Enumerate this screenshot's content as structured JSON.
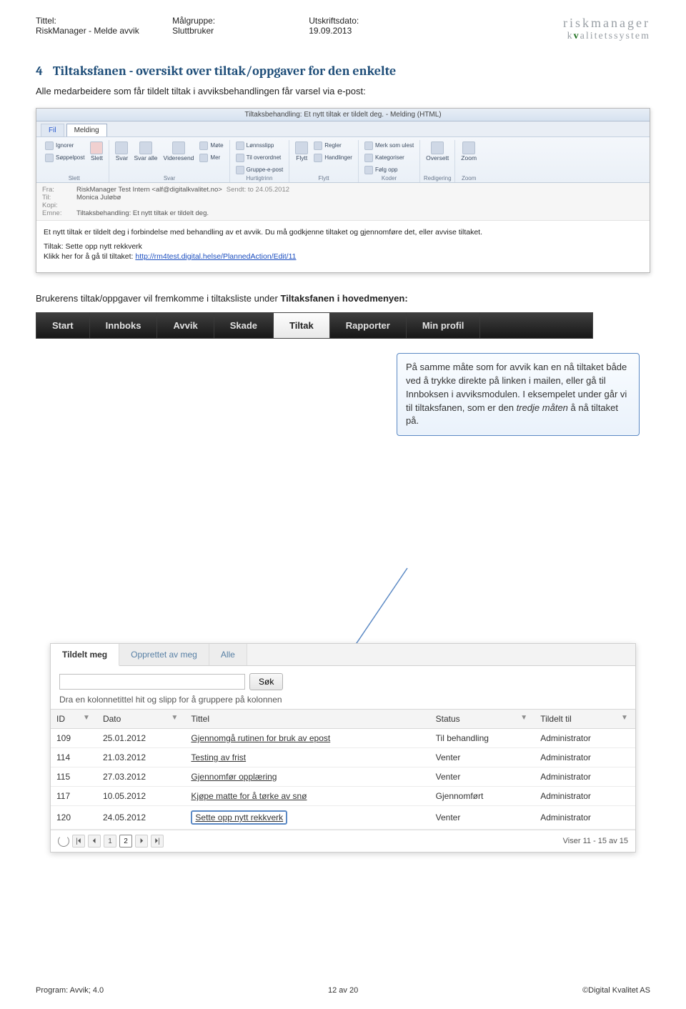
{
  "header": {
    "title_label": "Tittel:",
    "title_value": "RiskManager - Melde avvik",
    "audience_label": "Målgruppe:",
    "audience_value": "Sluttbruker",
    "date_label": "Utskriftsdato:",
    "date_value": "19.09.2013",
    "logo_line1": "riskmanager",
    "logo_line2_pre": "k",
    "logo_line2_mid": "v",
    "logo_line2_post": "alitetssystem"
  },
  "section": {
    "number": "4",
    "title": "Tiltaksfanen - oversikt over tiltak/oppgaver for den enkelte",
    "para1": "Alle medarbeidere som får tildelt tiltak i avviksbehandlingen får varsel via e-post:"
  },
  "outlook": {
    "window_title": "Tiltaksbehandling: Et nytt tiltak er tildelt deg. - Melding (HTML)",
    "tabs": {
      "file": "Fil",
      "message": "Melding"
    },
    "ribbon": {
      "ignore": "Ignorer",
      "junk": "Søppelpost",
      "delete": "Slett",
      "reply": "Svar",
      "replyall": "Svar alle",
      "forward": "Videresend",
      "more": "Mer",
      "payslip": "Lønnsslipp",
      "to_superv": "Til overordnet",
      "group_mail": "Gruppe-e-post",
      "meeting": "Møte",
      "rules": "Regler",
      "actions": "Handlinger",
      "move": "Flytt",
      "mark_unread": "Merk som ulest",
      "categorize": "Kategoriser",
      "followup": "Følg opp",
      "translate": "Oversett",
      "zoom": "Zoom",
      "g_delete": "Slett",
      "g_reply": "Svar",
      "g_quick": "Hurtigtrinn",
      "g_move": "Flytt",
      "g_codes": "Koder",
      "g_edit": "Redigering",
      "g_zoom": "Zoom"
    },
    "meta": {
      "from_label": "Fra:",
      "from_value": "RiskManager Test Intern <alf@digitalkvalitet.no>",
      "sent_label": "Sendt:",
      "sent_value": "to 24.05.2012",
      "to_label": "Til:",
      "to_value": "Monica Juløbø",
      "cc_label": "Kopi:",
      "subject_label": "Emne:",
      "subject_value": "Tiltaksbehandling: Et nytt tiltak er tildelt deg."
    },
    "body": {
      "line1": "Et nytt tiltak er tildelt deg i forbindelse med behandling av et avvik. Du må godkjenne tiltaket og gjennomføre det, eller avvise tiltaket.",
      "line2": "Tiltak: Sette opp nytt rekkverk",
      "line3_pre": "Klikk her for å gå til tiltaket: ",
      "link_text": "http://rm4test.digital.helse/PlannedAction/Edit/11"
    }
  },
  "para2_pre": "Brukerens tiltak/oppgaver vil fremkomme i tiltaksliste under ",
  "para2_bold": "Tiltaksfanen i hovedmenyen:",
  "mainmenu": {
    "items": [
      "Start",
      "Innboks",
      "Avvik",
      "Skade",
      "Tiltak",
      "Rapporter",
      "Min profil"
    ],
    "active_index": 4
  },
  "callout": {
    "text_pre": "På samme måte som for avvik kan en nå tiltaket både ved å trykke direkte på linken i mailen, eller gå til Innboksen i avviksmodulen. I eksempelet under går vi til tiltaksfanen, som er den ",
    "text_em": "tredje måten",
    "text_post": " å nå tiltaket på."
  },
  "app": {
    "tabs": {
      "assigned": "Tildelt meg",
      "created": "Opprettet av meg",
      "all": "Alle"
    },
    "search_button": "Søk",
    "search_placeholder": "",
    "group_hint": "Dra en kolonnetittel hit og slipp for å gruppere på kolonnen",
    "columns": {
      "id": "ID",
      "date": "Dato",
      "title": "Tittel",
      "status": "Status",
      "assigned": "Tildelt til"
    },
    "rows": [
      {
        "id": "109",
        "date": "25.01.2012",
        "title": "Gjennomgå rutinen for bruk av epost",
        "status": "Til behandling",
        "assigned": "Administrator"
      },
      {
        "id": "114",
        "date": "21.03.2012",
        "title": "Testing av frist",
        "status": "Venter",
        "assigned": "Administrator"
      },
      {
        "id": "115",
        "date": "27.03.2012",
        "title": "Gjennomfør opplæring",
        "status": "Venter",
        "assigned": "Administrator"
      },
      {
        "id": "117",
        "date": "10.05.2012",
        "title": "Kjøpe matte for å tørke av snø",
        "status": "Gjennomført",
        "assigned": "Administrator"
      },
      {
        "id": "120",
        "date": "24.05.2012",
        "title": "Sette opp nytt rekkverk",
        "status": "Venter",
        "assigned": "Administrator"
      }
    ],
    "pager": {
      "first": "|⏴",
      "prev": "⏴",
      "pages": [
        "1",
        "2"
      ],
      "next": "⏵",
      "last": "⏵|",
      "active_page": 1
    },
    "footer_right": "Viser 11 - 15 av 15"
  },
  "footer": {
    "left": "Program:  Avvik; 4.0",
    "center": "12 av 20",
    "right": "©Digital Kvalitet AS"
  }
}
